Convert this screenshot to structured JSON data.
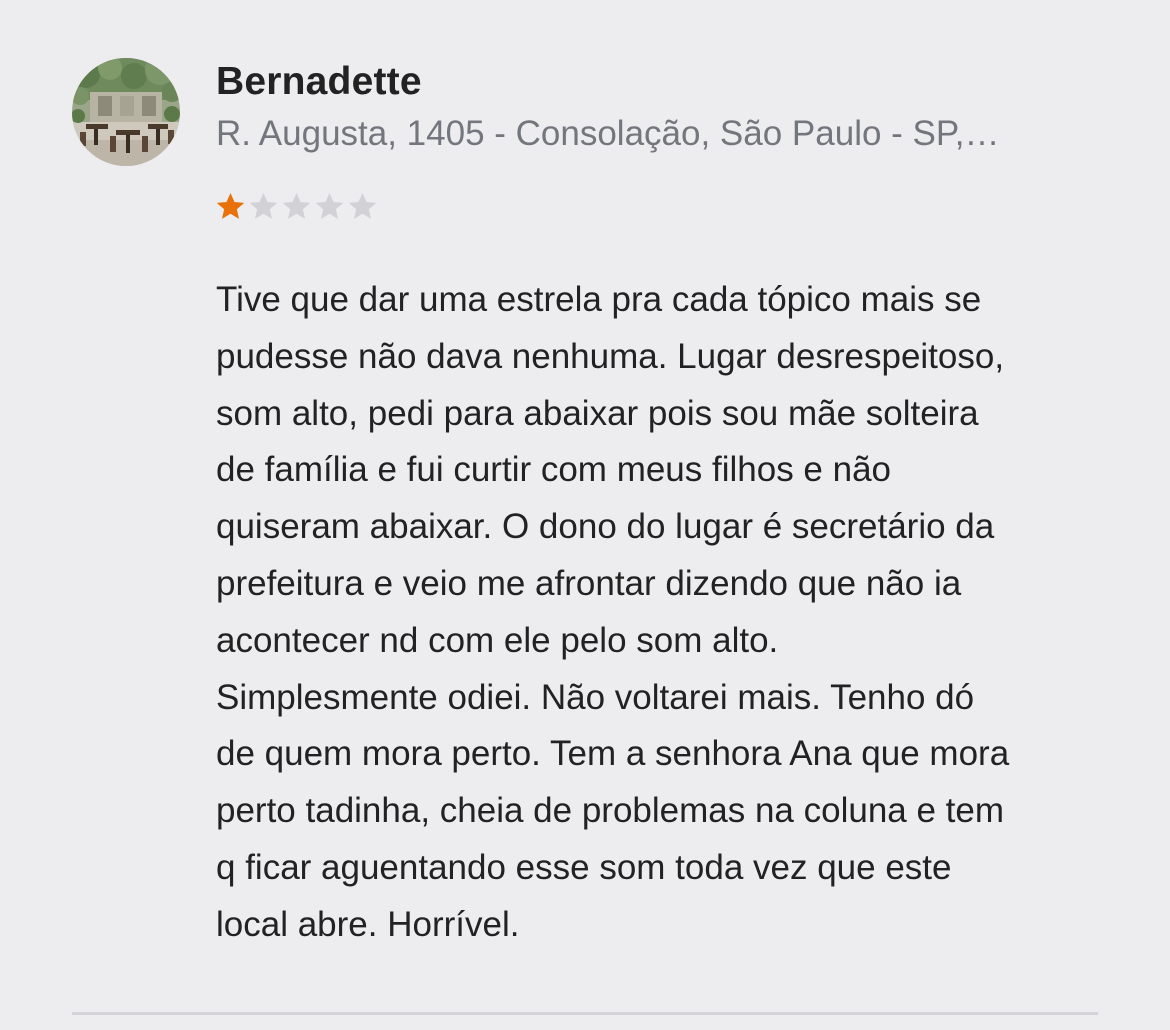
{
  "review": {
    "author": "Bernadette",
    "address": "R. Augusta, 1405 - Consolação, São Paulo - SP,…",
    "rating": 1,
    "rating_max": 5,
    "star_filled_color": "#e8710a",
    "star_empty_color": "#d2d2d6",
    "avatar_icon": "restaurant-photo-avatar",
    "text": "Tive que dar uma estrela pra cada tópico mais se\npudesse não dava nenhuma. Lugar desrespeitoso,\nsom alto, pedi para abaixar pois sou mãe solteira\nde família e fui curtir com meus filhos e não\nquiseram abaixar. O dono do lugar é secretário da\nprefeitura e veio me afrontar dizendo que não ia\nacontecer nd com ele pelo som alto.\nSimplesmente odiei. Não voltarei mais. Tenho dó\nde quem mora perto. Tem a senhora Ana que mora\nperto tadinha, cheia de problemas na coluna e tem\nq ficar aguentando esse som toda vez que este\nlocal abre. Horrível."
  }
}
